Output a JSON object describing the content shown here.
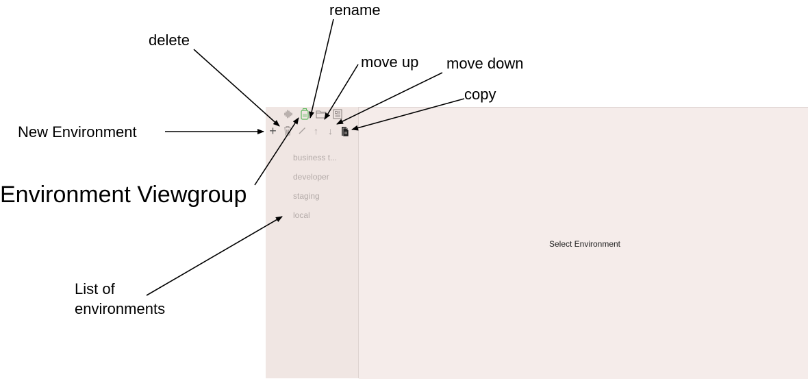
{
  "annotations": {
    "rename": "rename",
    "delete": "delete",
    "move_up": "move up",
    "move_down": "move down",
    "copy": "copy",
    "new_environment": "New Environment",
    "environment_viewgroup": "Environment Viewgroup",
    "list_of_environments_line1": "List of",
    "list_of_environments_line2": "environments"
  },
  "viewgroup": {
    "icons": [
      "waveform-icon",
      "environment-icon",
      "folder-icon",
      "document-list-icon"
    ],
    "active_icon": "environment-icon",
    "active_color": "#5cb85c"
  },
  "toolbar": {
    "icons": [
      "plus-icon",
      "trash-icon",
      "pencil-icon",
      "arrow-up-icon",
      "arrow-down-icon",
      "copy-icon"
    ],
    "new_symbol": "+",
    "up_symbol": "↑",
    "down_symbol": "↓"
  },
  "environments": [
    {
      "name": "business t..."
    },
    {
      "name": "developer"
    },
    {
      "name": "staging"
    },
    {
      "name": "local"
    }
  ],
  "main": {
    "empty_message": "Select Environment"
  },
  "colors": {
    "sidebar_bg": "#f0e6e3",
    "main_bg": "#f5ecea",
    "muted_text": "#b3aaa8",
    "icon_gray": "#8e8684"
  }
}
